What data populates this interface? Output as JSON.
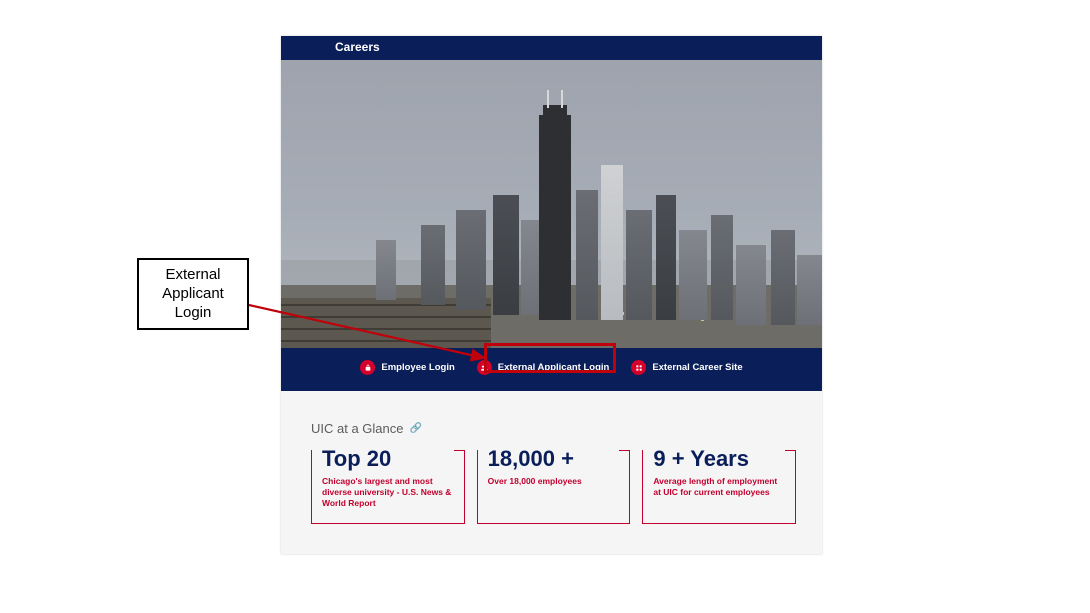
{
  "topbar": {
    "title": "Careers"
  },
  "nav": {
    "employee_label": "Employee Login",
    "external_applicant_label": "External Applicant Login",
    "career_site_label": "External Career Site"
  },
  "callout": {
    "line1": "External",
    "line2": "Applicant",
    "line3": "Login"
  },
  "glance": {
    "heading": "UIC at a Glance",
    "cards": [
      {
        "headline": "Top 20",
        "desc": "Chicago's largest and most diverse university - U.S. News & World Report"
      },
      {
        "headline": "18,000 +",
        "desc": "Over 18,000 employees"
      },
      {
        "headline": "9 + Years",
        "desc": "Average length of employment at UIC for current employees"
      }
    ]
  }
}
